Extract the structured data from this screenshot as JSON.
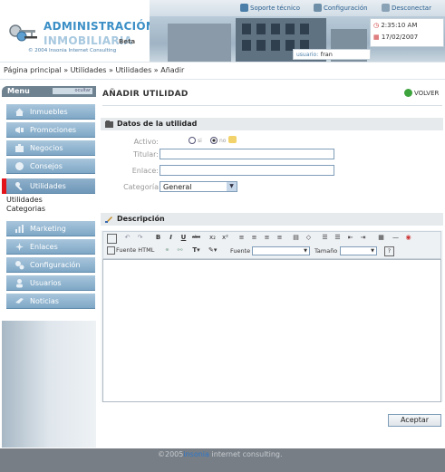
{
  "header": {
    "logo_title_1": "ADMINISTRACIÓN",
    "logo_title_2": "INMOBILIARIA",
    "logo_beta": "Beta",
    "logo_copyright": "© 2004 Insonia Internet Consulting",
    "links": [
      "Soporte técnico",
      "Configuración",
      "Desconectar"
    ],
    "time": "2:35:10 AM",
    "date": "17/02/2007",
    "user_label": "usuario:",
    "user_name": "fran"
  },
  "breadcrumb": "Página principal » Utilidades » Utilidades » Añadir",
  "sidebar": {
    "title": "Menu",
    "hide_label": "ocultar",
    "items": [
      {
        "label": "Inmuebles",
        "icon": "house-icon"
      },
      {
        "label": "Promociones",
        "icon": "megaphone-icon"
      },
      {
        "label": "Negocios",
        "icon": "briefcase-icon"
      },
      {
        "label": "Consejos",
        "icon": "globe-icon"
      },
      {
        "label": "Utilidades",
        "icon": "wrench-icon"
      },
      {
        "label": "Marketing",
        "icon": "chart-icon"
      },
      {
        "label": "Enlaces",
        "icon": "link-icon"
      },
      {
        "label": "Configuración",
        "icon": "gears-icon"
      },
      {
        "label": "Usuarios",
        "icon": "user-icon"
      },
      {
        "label": "Noticias",
        "icon": "news-icon"
      }
    ],
    "submenu": [
      "Utilidades",
      "Categorias"
    ]
  },
  "main": {
    "title": "AÑADIR UTILIDAD",
    "back_label": "VOLVER",
    "section1": "Datos de la utilidad",
    "activo_label": "Activo:",
    "activo_si": "si",
    "activo_no": "no",
    "titular_label": "Titular:",
    "enlace_label": "Enlace:",
    "categoria_label": "Categoría",
    "categoria_value": "General",
    "section2": "Descripción",
    "toolbar": {
      "font_html": "Fuente HTML",
      "fuente_label": "Fuente",
      "tamano_label": "Tamaño"
    },
    "accept_label": "Aceptar"
  },
  "footer": {
    "prefix": "©2005",
    "brand": "insonia",
    "suffix": "internet consulting."
  },
  "colors": {
    "accent": "#3b8fc6",
    "menu": "#7ea7c6",
    "active_marker": "#e2141a"
  }
}
